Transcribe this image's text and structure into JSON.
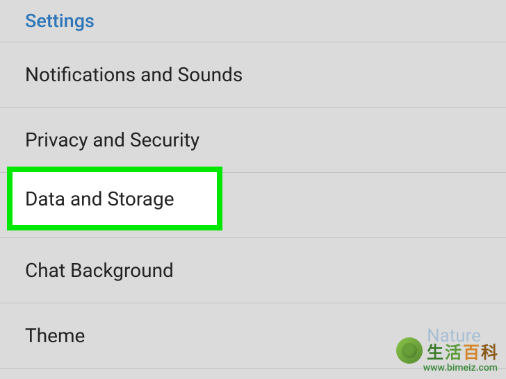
{
  "header": {
    "title": "Settings"
  },
  "items": [
    {
      "label": "Notifications and Sounds"
    },
    {
      "label": "Privacy and Security"
    },
    {
      "label": "Data and Storage"
    },
    {
      "label": "Chat Background"
    },
    {
      "label": "Theme",
      "value": "Nature"
    }
  ],
  "highlighted_item_index": 2,
  "watermark": {
    "chinese": [
      "生",
      "活",
      "百",
      "科"
    ],
    "url": "www.bimeiz.com"
  }
}
